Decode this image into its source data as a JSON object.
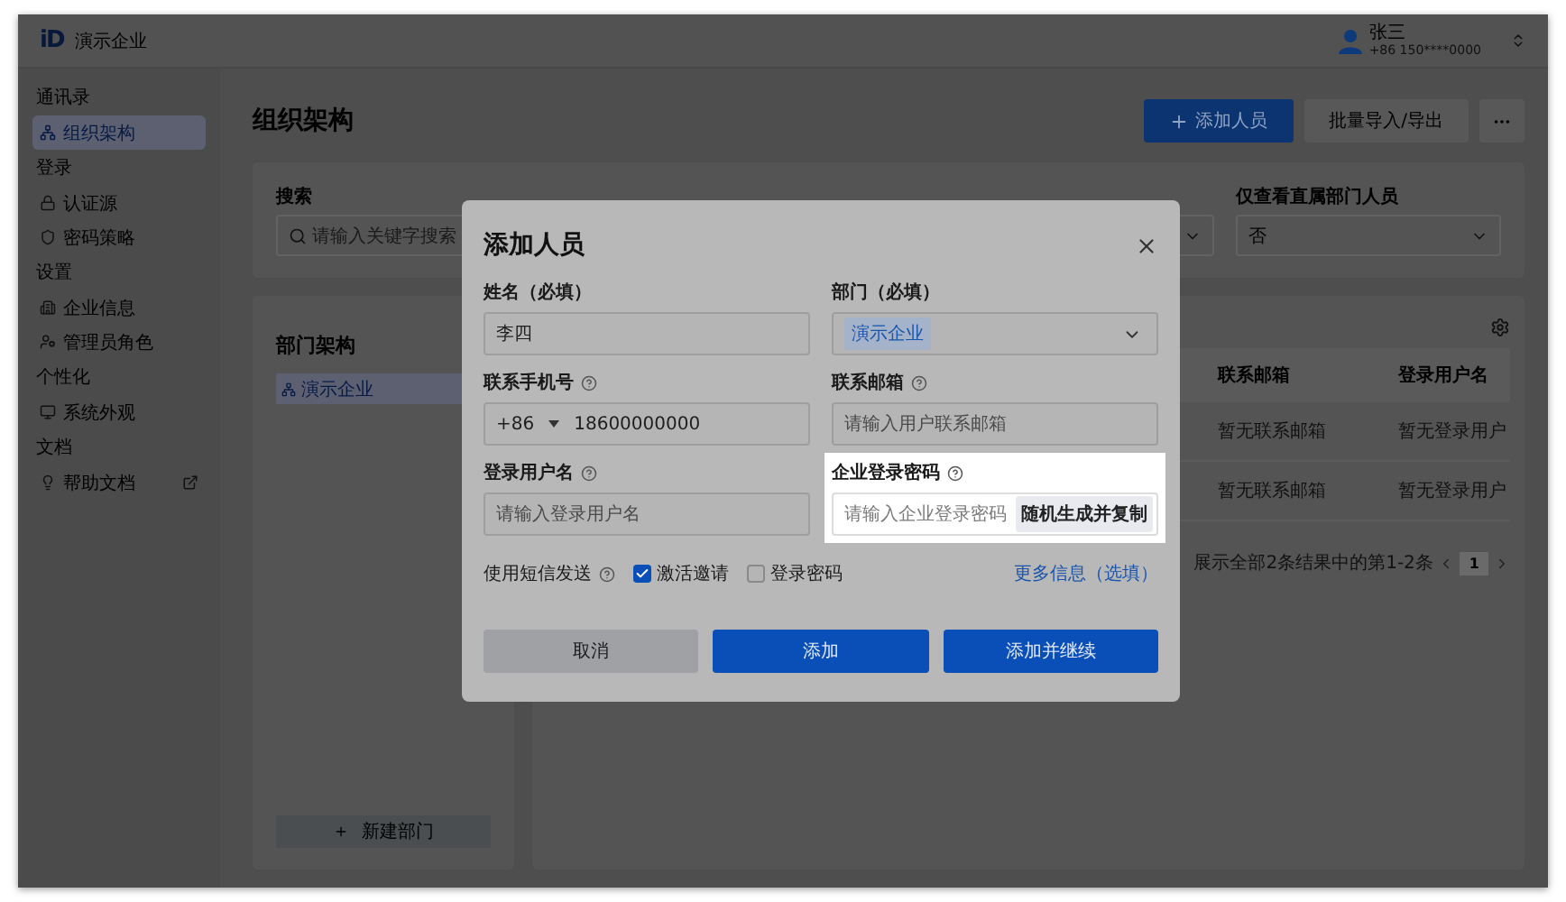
{
  "app": {
    "logo": "iD",
    "name": "演示企业",
    "user": {
      "name": "张三",
      "phone": "+86 150****0000"
    }
  },
  "sidebar": [
    {
      "section": "通讯录",
      "items": [
        {
          "label": "组织架构",
          "selected": true
        }
      ]
    },
    {
      "section": "登录",
      "items": [
        {
          "label": "认证源",
          "selected": false
        },
        {
          "label": "密码策略",
          "selected": false
        }
      ]
    },
    {
      "section": "设置",
      "items": [
        {
          "label": "企业信息",
          "selected": false
        },
        {
          "label": "管理员角色",
          "selected": false
        }
      ]
    },
    {
      "section": "个性化",
      "items": [
        {
          "label": "系统外观",
          "selected": false
        }
      ]
    },
    {
      "section": "文档",
      "items": [
        {
          "label": "帮助文档",
          "selected": false,
          "external": true
        }
      ]
    }
  ],
  "page": {
    "title": "组织架构",
    "actions": [
      {
        "label": "添加人员",
        "kind": "primary"
      },
      {
        "label": "批量导入/导出",
        "kind": "secondary"
      },
      {
        "kind": "more"
      }
    ]
  },
  "filters": [
    {
      "label": "搜索",
      "kind": "search",
      "placeholder": "请输入关键字搜索"
    },
    {
      "kind": "select"
    },
    {
      "label": "仅查看直属部门人员",
      "kind": "select",
      "value": "否"
    }
  ],
  "departments": {
    "title": "部门架构",
    "tree": [
      {
        "label": "演示企业",
        "selected": true
      }
    ],
    "new_button": "新建部门"
  },
  "table": {
    "columns": [
      "联系邮箱",
      "登录用户名"
    ],
    "rows": [
      [
        "暂无联系邮箱",
        "暂无登录用户"
      ],
      [
        "暂无联系邮箱",
        "暂无登录用户"
      ]
    ],
    "summary": "展示全部2条结果中的第1-2条",
    "pages": [
      {
        "label": "1",
        "selected": true
      }
    ]
  },
  "modal": {
    "title": "添加人员",
    "fields": [
      {
        "label": "姓名（必填）",
        "kind": "text",
        "help": false,
        "highlighted": false,
        "value": "李四"
      },
      {
        "label": "部门（必填）",
        "kind": "select",
        "help": false,
        "highlighted": false,
        "tag": "演示企业"
      },
      {
        "label": "联系手机号",
        "kind": "phone",
        "help": true,
        "highlighted": false,
        "prefix": "+86",
        "value": "18600000000"
      },
      {
        "label": "联系邮箱",
        "kind": "text",
        "help": true,
        "highlighted": false,
        "placeholder": "请输入用户联系邮箱"
      },
      {
        "label": "登录用户名",
        "kind": "text",
        "help": true,
        "highlighted": false,
        "placeholder": "请输入登录用户名"
      },
      {
        "label": "企业登录密码",
        "kind": "password",
        "help": true,
        "highlighted": true,
        "placeholder": "请输入企业登录密码",
        "action": "随机生成并复制"
      }
    ],
    "sms": {
      "label": "使用短信发送",
      "options": [
        {
          "label": "激活邀请",
          "checked": true
        },
        {
          "label": "登录密码",
          "checked": false
        }
      ]
    },
    "more_link": "更多信息（选填）",
    "buttons": [
      {
        "label": "取消",
        "kind": "secondary"
      },
      {
        "label": "添加",
        "kind": "primary"
      },
      {
        "label": "添加并继续",
        "kind": "primary"
      }
    ]
  }
}
